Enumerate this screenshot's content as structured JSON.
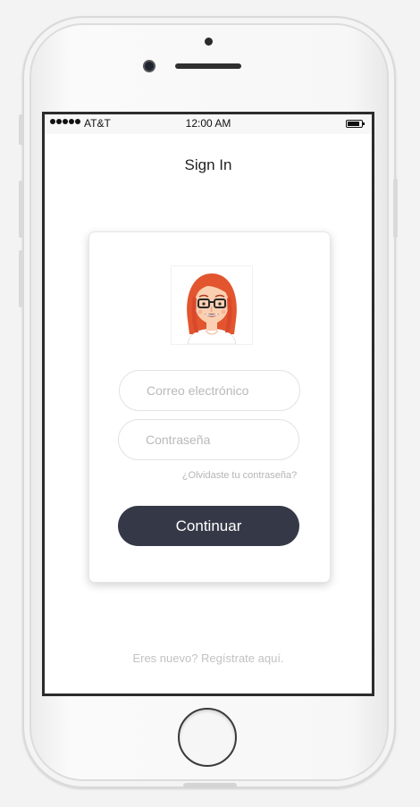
{
  "status_bar": {
    "carrier": "AT&T",
    "time": "12:00 AM"
  },
  "screen": {
    "title": "Sign In"
  },
  "form": {
    "email_placeholder": "Correo electrónico",
    "email_value": "",
    "password_placeholder": "Contraseña",
    "password_value": "",
    "forgot_label": "¿Olvidaste tu contraseña?",
    "continue_label": "Continuar"
  },
  "footer": {
    "register_label": "Eres nuevo? Regístrate aquí."
  },
  "colors": {
    "button_bg": "#353947",
    "placeholder_text": "#b9b9b9",
    "hair": "#e2552f",
    "skin": "#fbd0b2"
  },
  "icons": {
    "avatar": "user-avatar-glasses"
  }
}
